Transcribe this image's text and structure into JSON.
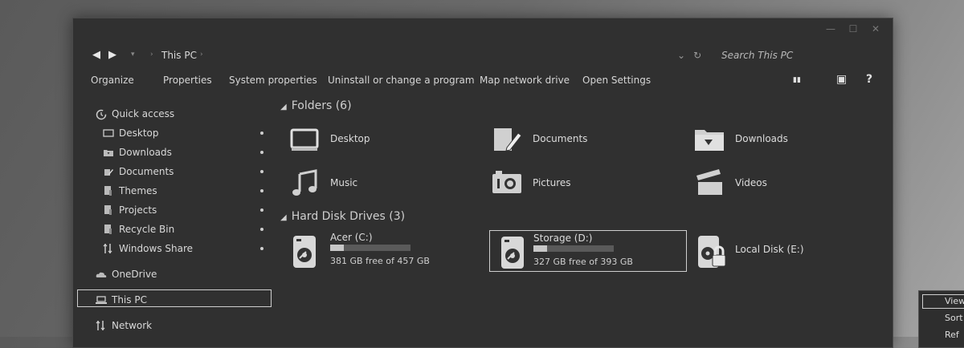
{
  "window": {
    "caption_buttons": [
      "—",
      "☐",
      "✕"
    ]
  },
  "address": {
    "back": "◀",
    "forward": "▶",
    "recent": "▾",
    "sep": "›",
    "crumb": "This PC",
    "dropdown": "⌄",
    "refresh": "↻",
    "search_placeholder": "Search This PC"
  },
  "commands": [
    "Organize",
    "Properties",
    "System properties",
    "Uninstall or change a program",
    "Map network drive",
    "Open Settings"
  ],
  "command_icons": {
    "view": "▮▮",
    "pane": "▣",
    "help": "?"
  },
  "nav": {
    "quick_access": "Quick access",
    "items": [
      "Desktop",
      "Downloads",
      "Documents",
      "Themes",
      "Projects",
      "Recycle Bin",
      "Windows Share"
    ],
    "onedrive": "OneDrive",
    "this_pc": "This PC",
    "network": "Network"
  },
  "groups": {
    "folders": {
      "arrow": "◢",
      "title": "Folders (6)"
    },
    "drives": {
      "arrow": "◢",
      "title": "Hard Disk Drives (3)"
    }
  },
  "folders": [
    "Desktop",
    "Documents",
    "Downloads",
    "Music",
    "Pictures",
    "Videos"
  ],
  "drives": [
    {
      "name": "Acer (C:)",
      "free": "381 GB free of 457 GB",
      "used_fraction": 0.17
    },
    {
      "name": "Storage (D:)",
      "free": "327 GB free of 393 GB",
      "used_fraction": 0.17
    },
    {
      "name": "Local Disk (E:)"
    }
  ],
  "context_menu": {
    "items": [
      "View",
      "Sort",
      "Ref"
    ]
  },
  "colors": {
    "window_bg": "#303030",
    "text": "#d8d8d8",
    "accent": "#cfcfcf"
  }
}
